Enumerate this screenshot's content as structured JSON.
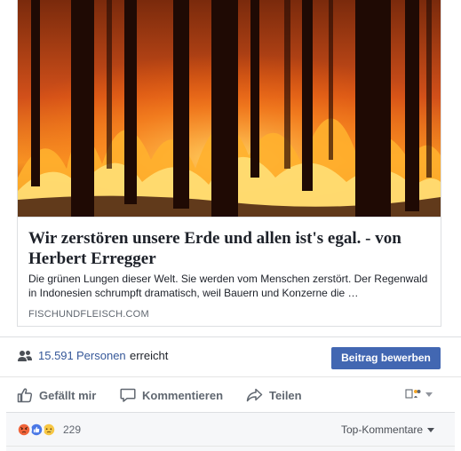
{
  "link_preview": {
    "image_icon": "forest-fire-photo",
    "title": "Wir zerstören unsere Erde und allen ist's egal. - von Herbert Erregger",
    "description": "Die grünen Lungen dieser Welt. Sie werden vom Menschen zerstört. Der Regenwald in Indonesien schrumpft dramatisch, weil Bauern und Konzerne die …",
    "domain": "FISCHUNDFLEISCH.COM"
  },
  "reach": {
    "icon": "people-icon",
    "count": "15.591",
    "unit": "Personen",
    "suffix": "erreicht",
    "promote_label": "Beitrag bewerben"
  },
  "actions": {
    "like_label": "Gefällt mir",
    "comment_label": "Kommentieren",
    "share_label": "Teilen",
    "audience_icon": "page-audience-icon"
  },
  "reactions": {
    "icons": [
      "angry-reaction-icon",
      "like-reaction-icon",
      "sad-reaction-icon"
    ],
    "count": "229",
    "sort_label": "Top-Kommentare"
  },
  "colors": {
    "link_blue": "#365899",
    "button_blue": "#4267b2",
    "muted_text": "#606770",
    "border": "#dddfe2"
  }
}
